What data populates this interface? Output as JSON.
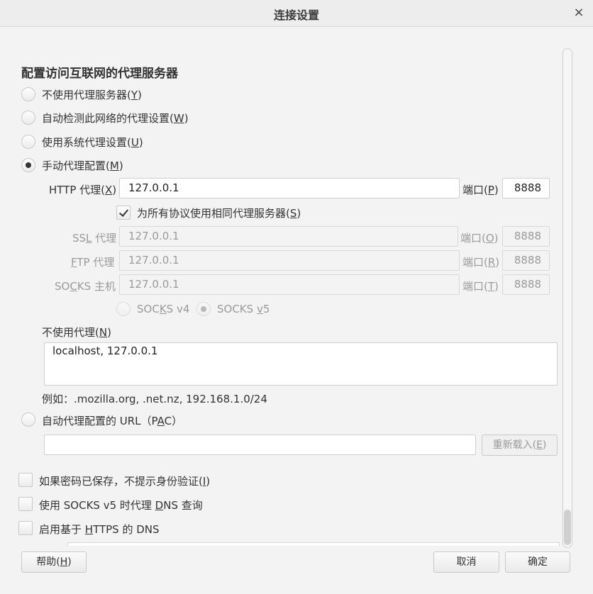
{
  "window": {
    "title": "连接设置",
    "close_icon": "×"
  },
  "heading": "配置访问互联网的代理服务器",
  "proxy_modes": [
    {
      "label": "不使用代理服务器(",
      "key": "Y",
      "checked": false
    },
    {
      "label": "自动检测此网络的代理设置(",
      "key": "W",
      "checked": false
    },
    {
      "label": "使用系统代理设置(",
      "key": "U",
      "checked": false
    },
    {
      "label": "手动代理配置(",
      "key": "M",
      "checked": true
    }
  ],
  "manual": {
    "http": {
      "label": "HTTP 代理(",
      "key": "X",
      "value": "127.0.0.1",
      "port_label": "端口(",
      "port_key": "P",
      "port": "8888"
    },
    "same_proxy": {
      "label": "为所有协议使用相同代理服务器(",
      "key": "S",
      "checked": true
    },
    "ssl": {
      "label_pre": "SS",
      "key": "L",
      "label_post": " 代理",
      "value": "127.0.0.1",
      "port_label": "端口(",
      "port_key": "O",
      "port": "8888"
    },
    "ftp": {
      "key": "F",
      "label_post": "TP 代理",
      "value": "127.0.0.1",
      "port_label": "端口(",
      "port_key": "R",
      "port": "8888"
    },
    "socks": {
      "label_pre": "SO",
      "key": "C",
      "label_post": "KS 主机",
      "value": "127.0.0.1",
      "port_label": "端口(",
      "port_key": "T",
      "port": "8888"
    },
    "socks_v4": {
      "label_pre": "SOC",
      "key": "K",
      "label_post": "S v4",
      "checked": false
    },
    "socks_v5": {
      "label_pre": "SOCKS ",
      "key": "v",
      "label_post": "5",
      "checked": true
    }
  },
  "no_proxy": {
    "label": "不使用代理(",
    "key": "N",
    "value": "localhost, 127.0.0.1",
    "example": "例如：.mozilla.org, .net.nz, 192.168.1.0/24"
  },
  "pac": {
    "label_pre": "自动代理配置的 URL（P",
    "key": "A",
    "label_post": "C）",
    "checked": false,
    "value": "",
    "reload_label": "重新载入(",
    "reload_key": "E"
  },
  "options": [
    {
      "label": "如果密码已保存，不提示身份验证(",
      "key": "I",
      "checked": false
    },
    {
      "label_pre": "使用 SOCKS v5 时代理 ",
      "key": "D",
      "label_post": "NS 查询",
      "checked": false
    },
    {
      "label_pre": "启用基于 ",
      "key": "H",
      "label_post": "TTPS 的 DNS",
      "checked": false
    }
  ],
  "footer": {
    "help_label": "帮助(",
    "help_key": "H",
    "cancel_label": "取消",
    "ok_label": "确定"
  }
}
